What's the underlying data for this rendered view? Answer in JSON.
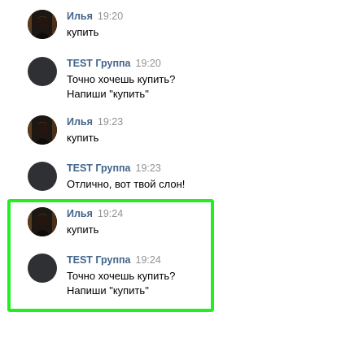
{
  "colors": {
    "author": "#42648b",
    "time": "#939393",
    "text": "#000000",
    "highlight_border": "#22ee22",
    "group_avatar": "#2f3033"
  },
  "messages": [
    {
      "author": "Илья",
      "time": "19:20",
      "avatar": "user-photo-avatar",
      "lines": [
        "купить"
      ]
    },
    {
      "author": "TEST Группа",
      "time": "19:20",
      "avatar": "group-avatar",
      "lines": [
        "Точно хочешь купить?",
        "Напиши \"купить\""
      ]
    },
    {
      "author": "Илья",
      "time": "19:23",
      "avatar": "user-photo-avatar",
      "lines": [
        "купить"
      ]
    },
    {
      "author": "TEST Группа",
      "time": "19:23",
      "avatar": "group-avatar",
      "lines": [
        "Отлично, вот твой слон!"
      ]
    },
    {
      "author": "Илья",
      "time": "19:24",
      "avatar": "user-photo-avatar",
      "lines": [
        "купить"
      ]
    },
    {
      "author": "TEST Группа",
      "time": "19:24",
      "avatar": "group-avatar",
      "lines": [
        "Точно хочешь купить?",
        "Напиши \"купить\""
      ]
    }
  ]
}
